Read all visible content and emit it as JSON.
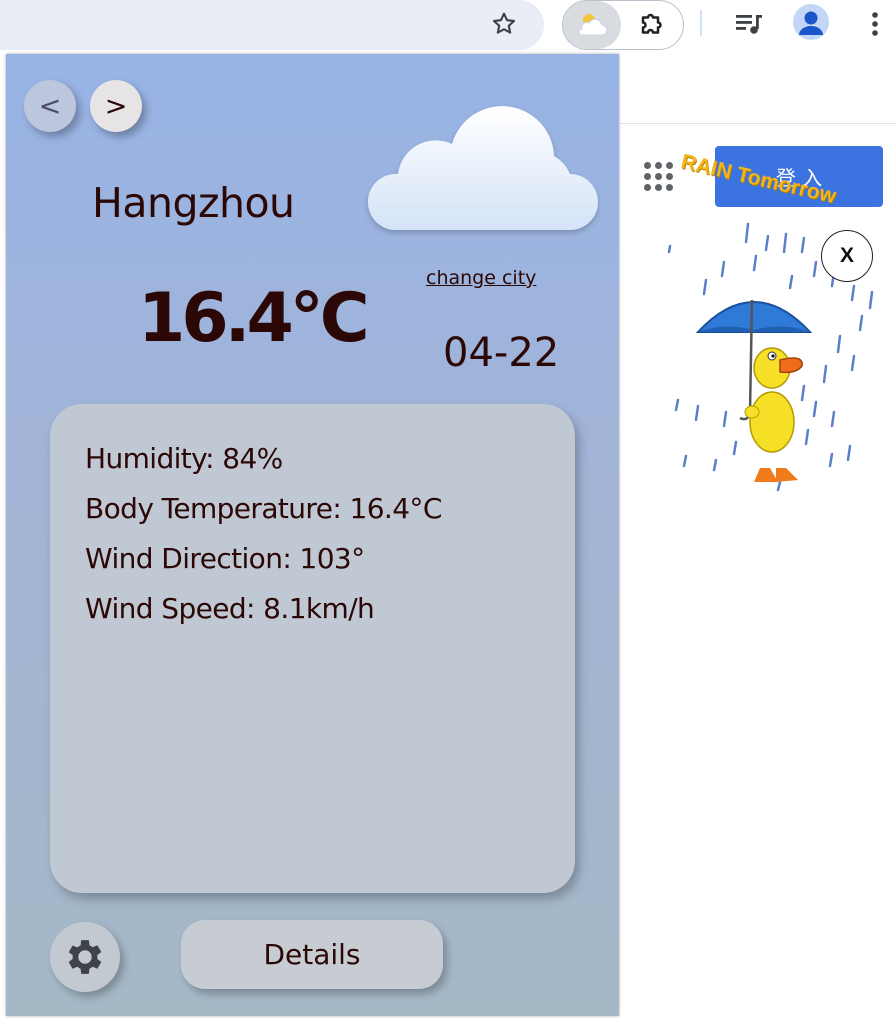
{
  "browser": {
    "icons": [
      "star-icon",
      "weather-extension-icon",
      "puzzle-icon",
      "media-queue-icon",
      "profile-icon",
      "more-vert-icon"
    ]
  },
  "background_page": {
    "signin_label": "登 入",
    "rain_banner": "RAIN Tomorrow",
    "close_label": "X",
    "icons": [
      "apps-grid-icon",
      "duck-umbrella-animation"
    ]
  },
  "popup": {
    "prev_label": "<",
    "next_label": ">",
    "city": "Hangzhou",
    "change_city_label": "change city",
    "temperature": "16.4°C",
    "date": "04-22",
    "weather_icon": "cloud-icon",
    "details": {
      "humidity": "Humidity: 84%",
      "body_temperature": "Body Temperature: 16.4°C",
      "wind_direction": "Wind Direction: 103°",
      "wind_speed": "Wind Speed: 8.1km/h"
    },
    "settings_icon": "gear-icon",
    "details_button_label": "Details"
  },
  "colors": {
    "text": "#2b0806",
    "signin_button": "#3b73e1",
    "rain_banner": "#f2b51a"
  }
}
